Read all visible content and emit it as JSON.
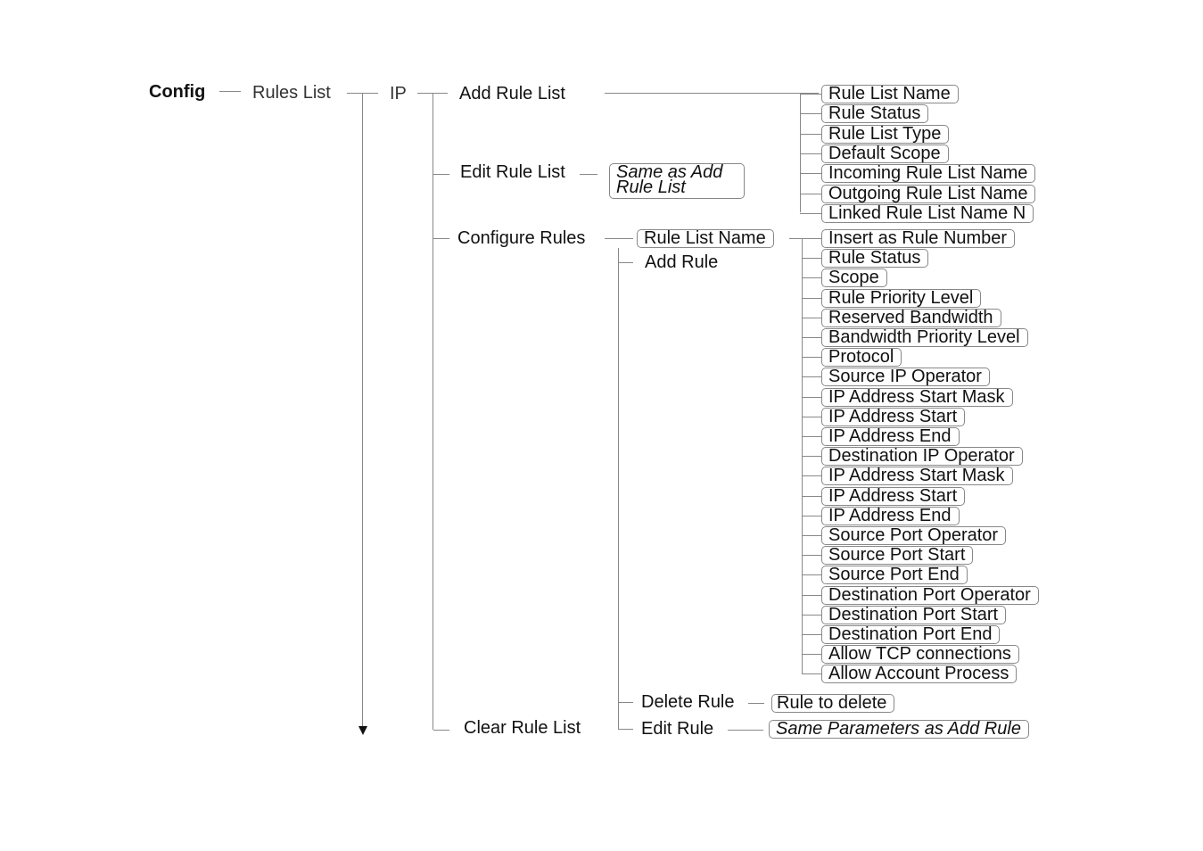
{
  "root": "Config",
  "rules_list": "Rules List",
  "ip": "IP",
  "add_rule_list": {
    "label": "Add Rule List",
    "params": [
      "Rule List Name",
      "Rule Status",
      "Rule List Type",
      "Default Scope",
      "Incoming Rule List Name",
      "Outgoing Rule List Name",
      "Linked Rule List Name N"
    ]
  },
  "edit_rule_list": {
    "label": "Edit Rule List",
    "note_line1": "Same as Add",
    "note_line2": "Rule List"
  },
  "configure_rules": {
    "label": "Configure Rules",
    "rule_list_name": "Rule List Name",
    "add_rule": {
      "label": "Add Rule",
      "params": [
        "Insert as Rule Number",
        "Rule Status",
        "Scope",
        "Rule Priority Level",
        "Reserved Bandwidth",
        "Bandwidth Priority Level",
        "Protocol",
        "Source IP Operator",
        "IP Address Start Mask",
        "IP Address Start",
        "IP Address End",
        "Destination IP Operator",
        "IP Address Start Mask",
        "IP Address Start",
        "IP Address End",
        "Source Port Operator",
        "Source Port Start",
        "Source Port End",
        "Destination Port Operator",
        "Destination Port Start",
        "Destination Port End",
        "Allow TCP connections",
        "Allow Account Process"
      ]
    },
    "delete_rule": {
      "label": "Delete Rule",
      "param": "Rule to delete"
    },
    "edit_rule": {
      "label": "Edit Rule",
      "note": "Same Parameters as Add Rule"
    }
  },
  "clear_rule_list": "Clear Rule List"
}
